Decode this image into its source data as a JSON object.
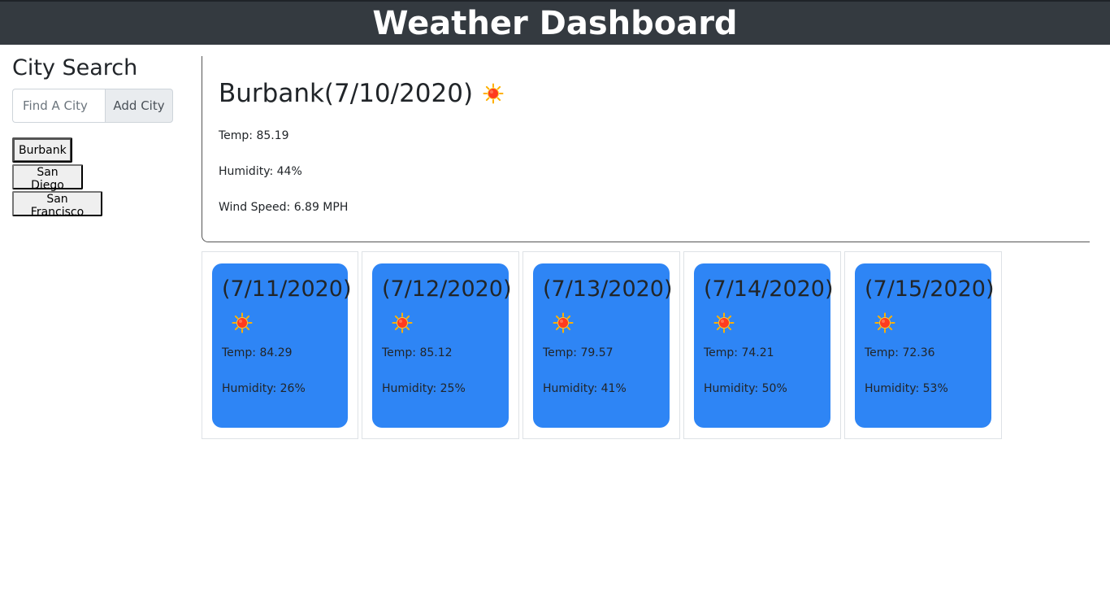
{
  "header": {
    "title": "Weather Dashboard"
  },
  "sidebar": {
    "title": "City Search",
    "search_placeholder": "Find A City",
    "add_label": "Add City",
    "cities": [
      "Burbank",
      "San Diego",
      "San Francisco"
    ]
  },
  "current": {
    "title": "Burbank(7/10/2020)",
    "icon": "sun-icon",
    "temp": "Temp: 85.19",
    "humidity": "Humidity: 44%",
    "wind": "Wind Speed: 6.89 MPH"
  },
  "forecast": [
    {
      "date": "(7/11/2020)",
      "icon": "sun-icon",
      "temp": "Temp: 84.29",
      "humidity": "Humidity: 26%"
    },
    {
      "date": "(7/12/2020)",
      "icon": "sun-icon",
      "temp": "Temp: 85.12",
      "humidity": "Humidity: 25%"
    },
    {
      "date": "(7/13/2020)",
      "icon": "sun-icon",
      "temp": "Temp: 79.57",
      "humidity": "Humidity: 41%"
    },
    {
      "date": "(7/14/2020)",
      "icon": "sun-icon",
      "temp": "Temp: 74.21",
      "humidity": "Humidity: 50%"
    },
    {
      "date": "(7/15/2020)",
      "icon": "sun-icon",
      "temp": "Temp: 72.36",
      "humidity": "Humidity: 53%"
    }
  ],
  "colors": {
    "header_bg": "#343a40",
    "card_bg": "#2e85f5",
    "sun": "#ff3b1f",
    "rays": "#ffb000"
  }
}
